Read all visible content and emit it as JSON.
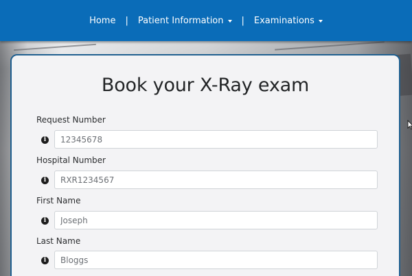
{
  "nav": {
    "home": "Home",
    "separator": "|",
    "patient_information": "Patient Information",
    "examinations": "Examinations"
  },
  "form": {
    "title": "Book your X-Ray exam",
    "fields": [
      {
        "label": "Request Number",
        "placeholder": "12345678"
      },
      {
        "label": "Hospital Number",
        "placeholder": "RXR1234567"
      },
      {
        "label": "First Name",
        "placeholder": "Joseph"
      },
      {
        "label": "Last Name",
        "placeholder": "Bloggs"
      }
    ],
    "info_icon": "i"
  },
  "colors": {
    "navbar": "#0a6cb8",
    "card_border": "#1f5f8f",
    "card_background": "#f3f3f5"
  },
  "icons": {
    "dropdown": "caret-down-icon",
    "info": "info-circle-icon",
    "pointer": "mouse-cursor-icon"
  }
}
